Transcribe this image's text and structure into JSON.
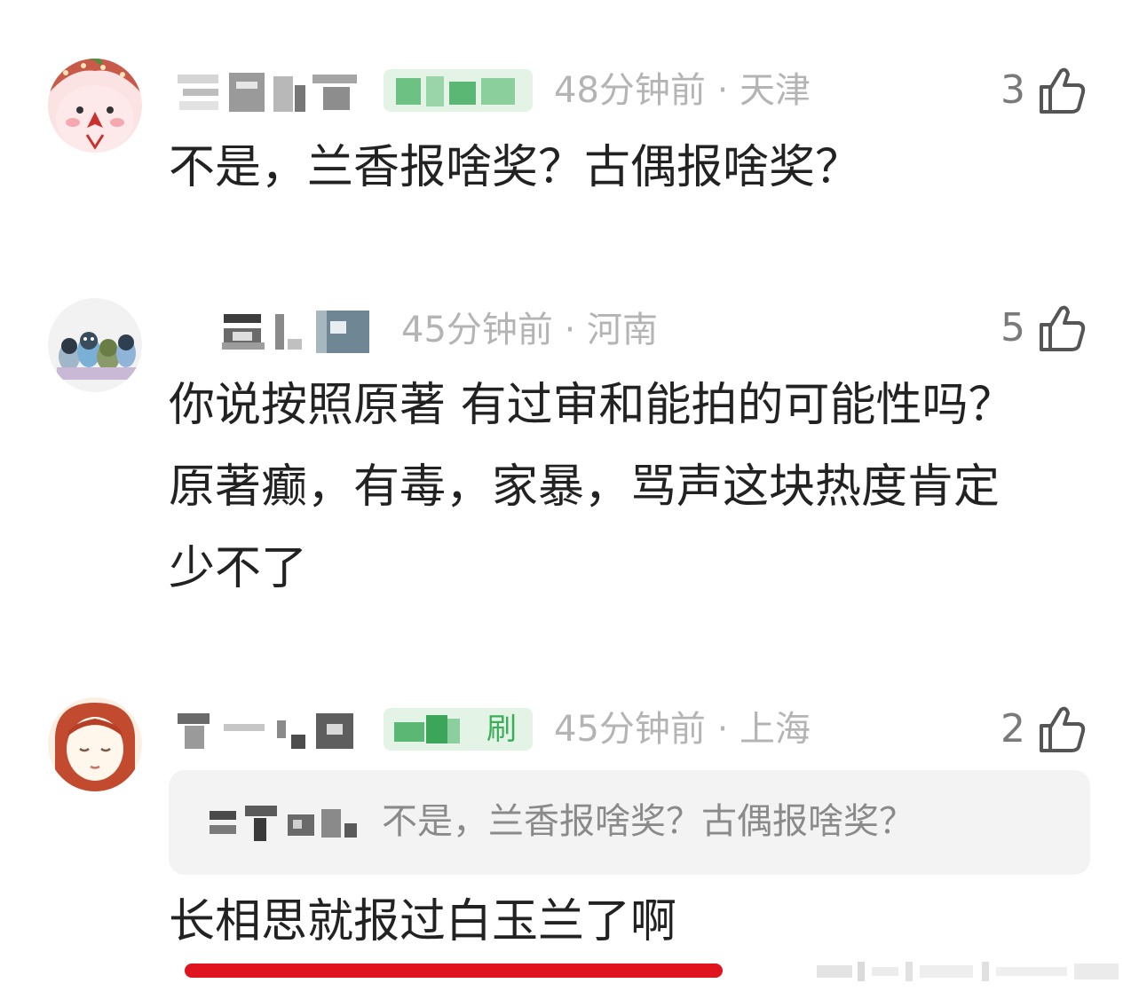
{
  "comments": [
    {
      "avatar": "strawberry-bird-avatar",
      "time_location": "48分钟前 · 天津",
      "like_count": "3",
      "text_lines": [
        "不是，兰香报啥奖？古偶报啥奖？"
      ]
    },
    {
      "avatar": "penguins-avatar",
      "time_location": "45分钟前 · 河南",
      "like_count": "5",
      "text_lines": [
        "你说按照原著 有过审和能拍的可能性吗？",
        "原著癫，有毒，家暴，骂声这块热度肯定",
        "少不了"
      ]
    },
    {
      "avatar": "red-hair-girl-avatar",
      "tag_visible_text": "刷",
      "time_location": "45分钟前 · 上海",
      "like_count": "2",
      "quote_text": "不是，兰香报啥奖？古偶报啥奖？",
      "text_lines": [
        "长相思就报过白玉兰了啊"
      ]
    }
  ],
  "icons": {
    "like": "thumbs-up-icon"
  },
  "colors": {
    "tag_bg": "#e3f4e7",
    "tag_text": "#3cae5a",
    "meta_text": "#b4b4b4",
    "body_text": "#222222",
    "quote_bg": "#f3f3f3",
    "underline": "#e0141e"
  }
}
